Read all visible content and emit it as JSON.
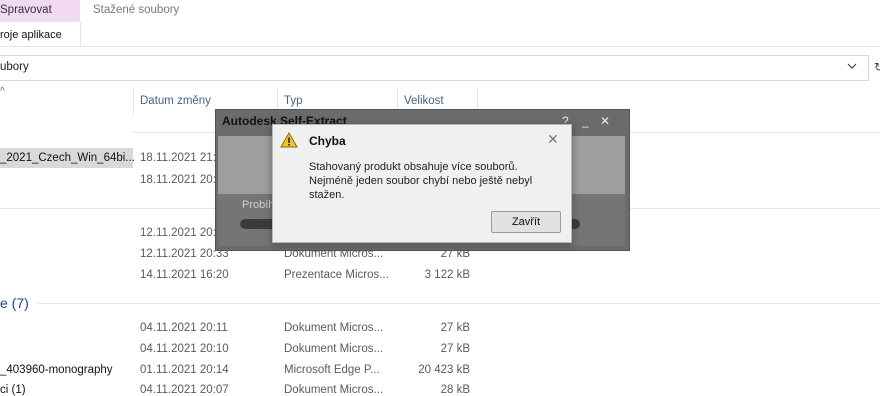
{
  "ribbon": {
    "manage_tab": "Spravovat",
    "tools_tab": "roje aplikace",
    "downloads_tab": "Stažené soubory"
  },
  "address": {
    "path": "ubory",
    "refresh_glyph": "↻"
  },
  "columns": {
    "date": "Datum změny",
    "type": "Typ",
    "size": "Velikost"
  },
  "groups": [
    {
      "title": "e (7)"
    }
  ],
  "rows": [
    {
      "name": "_2021_Czech_Win_64bi...",
      "date": "18.11.2021 21:4",
      "type": "",
      "size": ""
    },
    {
      "name": "",
      "date": "18.11.2021 20:3",
      "type": "",
      "size": ""
    },
    {
      "name": "",
      "date": "12.11.2021 20:3",
      "type": "",
      "size": ""
    },
    {
      "name": "",
      "date": "12.11.2021 20:33",
      "type": "Dokument Micros...",
      "size": "27 kB"
    },
    {
      "name": "",
      "date": "14.11.2021 16:20",
      "type": "Prezentace Micros...",
      "size": "3 122 kB"
    },
    {
      "name": "",
      "date": "04.11.2021 20:11",
      "type": "Dokument Micros...",
      "size": "27 kB"
    },
    {
      "name": "",
      "date": "04.11.2021 20:10",
      "type": "Dokument Micros...",
      "size": "27 kB"
    },
    {
      "name": "_403960-monography",
      "date": "01.11.2021 20:14",
      "type": "Microsoft Edge P...",
      "size": "20 423 kB"
    },
    {
      "name": "ci (1)",
      "date": "04.11.2021 20:07",
      "type": "Dokument Micros...",
      "size": "28 kB"
    }
  ],
  "bg_dialog": {
    "title": "Autodesk Self-Extract",
    "progress_label": "Probíh",
    "min": "_",
    "close": "✕",
    "help": "?"
  },
  "error_dialog": {
    "title": "Chyba",
    "message": "Stahovaný produkt obsahuje více souborů. Nejméně jeden soubor chybí nebo ještě nebyl stažen.",
    "close_glyph": "✕",
    "button": "Zavřít"
  }
}
